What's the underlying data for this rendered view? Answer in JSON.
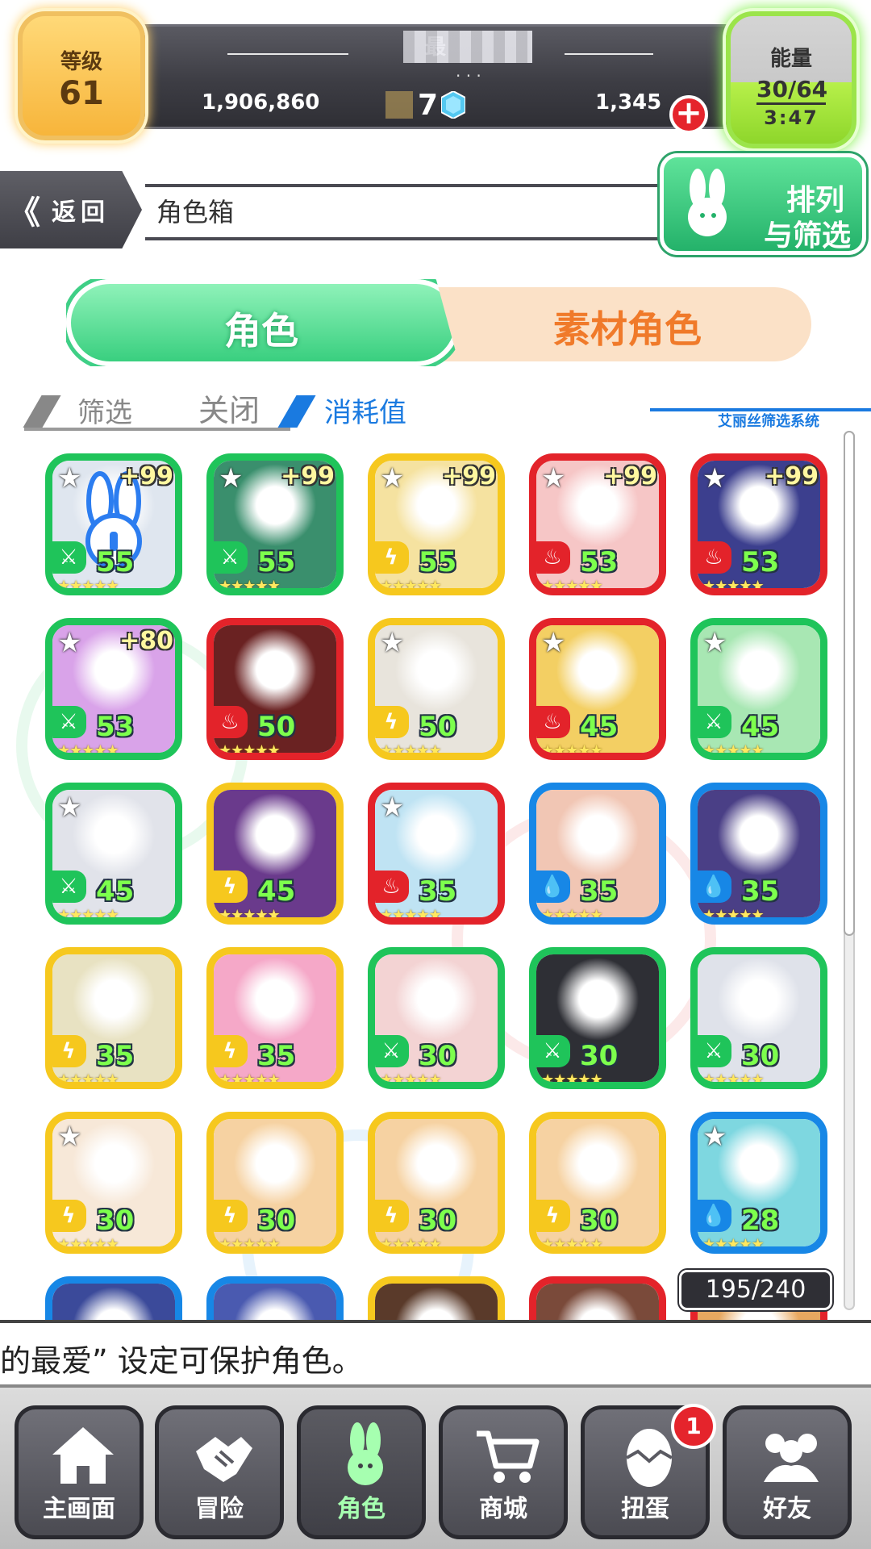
{
  "top": {
    "level_label": "等级",
    "level_value": "61",
    "player_name": "最",
    "gold": "1,906,860",
    "gems": "7",
    "stamina_currency": "1,345",
    "add_label": "+",
    "energy_label": "能量",
    "energy_value": "30/64",
    "energy_timer": "3:47"
  },
  "header": {
    "back_chevron": "《",
    "back_label": "返回",
    "page_title": "角色箱",
    "sort_line1": "排列",
    "sort_line2": "与筛选"
  },
  "tabs": {
    "character": "角色",
    "material": "素材角色"
  },
  "filter": {
    "label": "筛选",
    "state": "关闭",
    "sort_key": "消耗值",
    "system": "艾丽丝筛选系统"
  },
  "colors": {
    "green": "#1fc45a",
    "red": "#e3232a",
    "yellow": "#f6c81e",
    "blue": "#1787e6"
  },
  "elements": {
    "wind": "⚔",
    "fire": "♨",
    "thunder": "ϟ",
    "water": "💧"
  },
  "cards": [
    {
      "color": "green",
      "element": "wind",
      "level": "55",
      "plus": "+99",
      "fav": true,
      "art": "#dfe6ef"
    },
    {
      "color": "green",
      "element": "wind",
      "level": "55",
      "plus": "+99",
      "fav": true,
      "art": "#3a8f6d"
    },
    {
      "color": "yellow",
      "element": "thunder",
      "level": "55",
      "plus": "+99",
      "fav": true,
      "art": "#f5e2a0"
    },
    {
      "color": "red",
      "element": "fire",
      "level": "53",
      "plus": "+99",
      "fav": true,
      "art": "#f6c6c6"
    },
    {
      "color": "red",
      "element": "fire",
      "level": "53",
      "plus": "+99",
      "fav": true,
      "art": "#3c3f8e"
    },
    {
      "color": "green",
      "element": "wind",
      "level": "53",
      "plus": "+80",
      "fav": true,
      "art": "#d9a3e9"
    },
    {
      "color": "red",
      "element": "fire",
      "level": "50",
      "plus": "",
      "fav": false,
      "art": "#6a2222"
    },
    {
      "color": "yellow",
      "element": "thunder",
      "level": "50",
      "plus": "",
      "fav": true,
      "art": "#e8e4dc"
    },
    {
      "color": "red",
      "element": "fire",
      "level": "45",
      "plus": "",
      "fav": true,
      "art": "#f3cf63"
    },
    {
      "color": "green",
      "element": "wind",
      "level": "45",
      "plus": "",
      "fav": true,
      "art": "#a8e7b3"
    },
    {
      "color": "green",
      "element": "wind",
      "level": "45",
      "plus": "",
      "fav": true,
      "art": "#e1e3ea"
    },
    {
      "color": "yellow",
      "element": "thunder",
      "level": "45",
      "plus": "",
      "fav": false,
      "art": "#6a3a8c"
    },
    {
      "color": "red",
      "element": "fire",
      "level": "35",
      "plus": "",
      "fav": true,
      "art": "#bfe3f3"
    },
    {
      "color": "blue",
      "element": "water",
      "level": "35",
      "plus": "",
      "fav": false,
      "art": "#f1c6b4"
    },
    {
      "color": "blue",
      "element": "water",
      "level": "35",
      "plus": "",
      "fav": false,
      "art": "#4a3f86"
    },
    {
      "color": "yellow",
      "element": "thunder",
      "level": "35",
      "plus": "",
      "fav": false,
      "art": "#e8e2c2"
    },
    {
      "color": "yellow",
      "element": "thunder",
      "level": "35",
      "plus": "",
      "fav": false,
      "art": "#f5a8c8"
    },
    {
      "color": "green",
      "element": "wind",
      "level": "30",
      "plus": "",
      "fav": false,
      "art": "#f3d3d3"
    },
    {
      "color": "green",
      "element": "wind",
      "level": "30",
      "plus": "",
      "fav": false,
      "art": "#2e2f35"
    },
    {
      "color": "green",
      "element": "wind",
      "level": "30",
      "plus": "",
      "fav": false,
      "art": "#dfe2ea"
    },
    {
      "color": "yellow",
      "element": "thunder",
      "level": "30",
      "plus": "",
      "fav": true,
      "art": "#f7e8d8"
    },
    {
      "color": "yellow",
      "element": "thunder",
      "level": "30",
      "plus": "",
      "fav": false,
      "art": "#f6d2a2"
    },
    {
      "color": "yellow",
      "element": "thunder",
      "level": "30",
      "plus": "",
      "fav": false,
      "art": "#f6d2a2"
    },
    {
      "color": "yellow",
      "element": "thunder",
      "level": "30",
      "plus": "",
      "fav": false,
      "art": "#f6d2a2"
    },
    {
      "color": "blue",
      "element": "water",
      "level": "28",
      "plus": "",
      "fav": true,
      "art": "#7ed7e0"
    },
    {
      "color": "blue",
      "element": "water",
      "level": "",
      "plus": "",
      "fav": false,
      "art": "#3b4a9a"
    },
    {
      "color": "blue",
      "element": "water",
      "level": "",
      "plus": "",
      "fav": false,
      "art": "#4a5ab0"
    },
    {
      "color": "yellow",
      "element": "thunder",
      "level": "",
      "plus": "",
      "fav": false,
      "art": "#5a3a2a"
    },
    {
      "color": "red",
      "element": "fire",
      "level": "",
      "plus": "",
      "fav": false,
      "art": "#7a4a3a"
    },
    {
      "color": "red",
      "element": "fire",
      "level": "",
      "plus": "",
      "fav": false,
      "art": "#e8a860"
    }
  ],
  "count": "195/240",
  "ticker": "的最爱” 设定可保护角色。",
  "nav": [
    {
      "id": "home",
      "label": "主画面",
      "icon": "home-icon"
    },
    {
      "id": "adventure",
      "label": "冒险",
      "icon": "handshake-icon"
    },
    {
      "id": "character",
      "label": "角色",
      "icon": "bunny-icon",
      "active": true
    },
    {
      "id": "shop",
      "label": "商城",
      "icon": "cart-icon"
    },
    {
      "id": "gacha",
      "label": "扭蛋",
      "icon": "egg-icon"
    },
    {
      "id": "friends",
      "label": "好友",
      "icon": "friends-icon"
    }
  ],
  "gacha_badge": "1"
}
